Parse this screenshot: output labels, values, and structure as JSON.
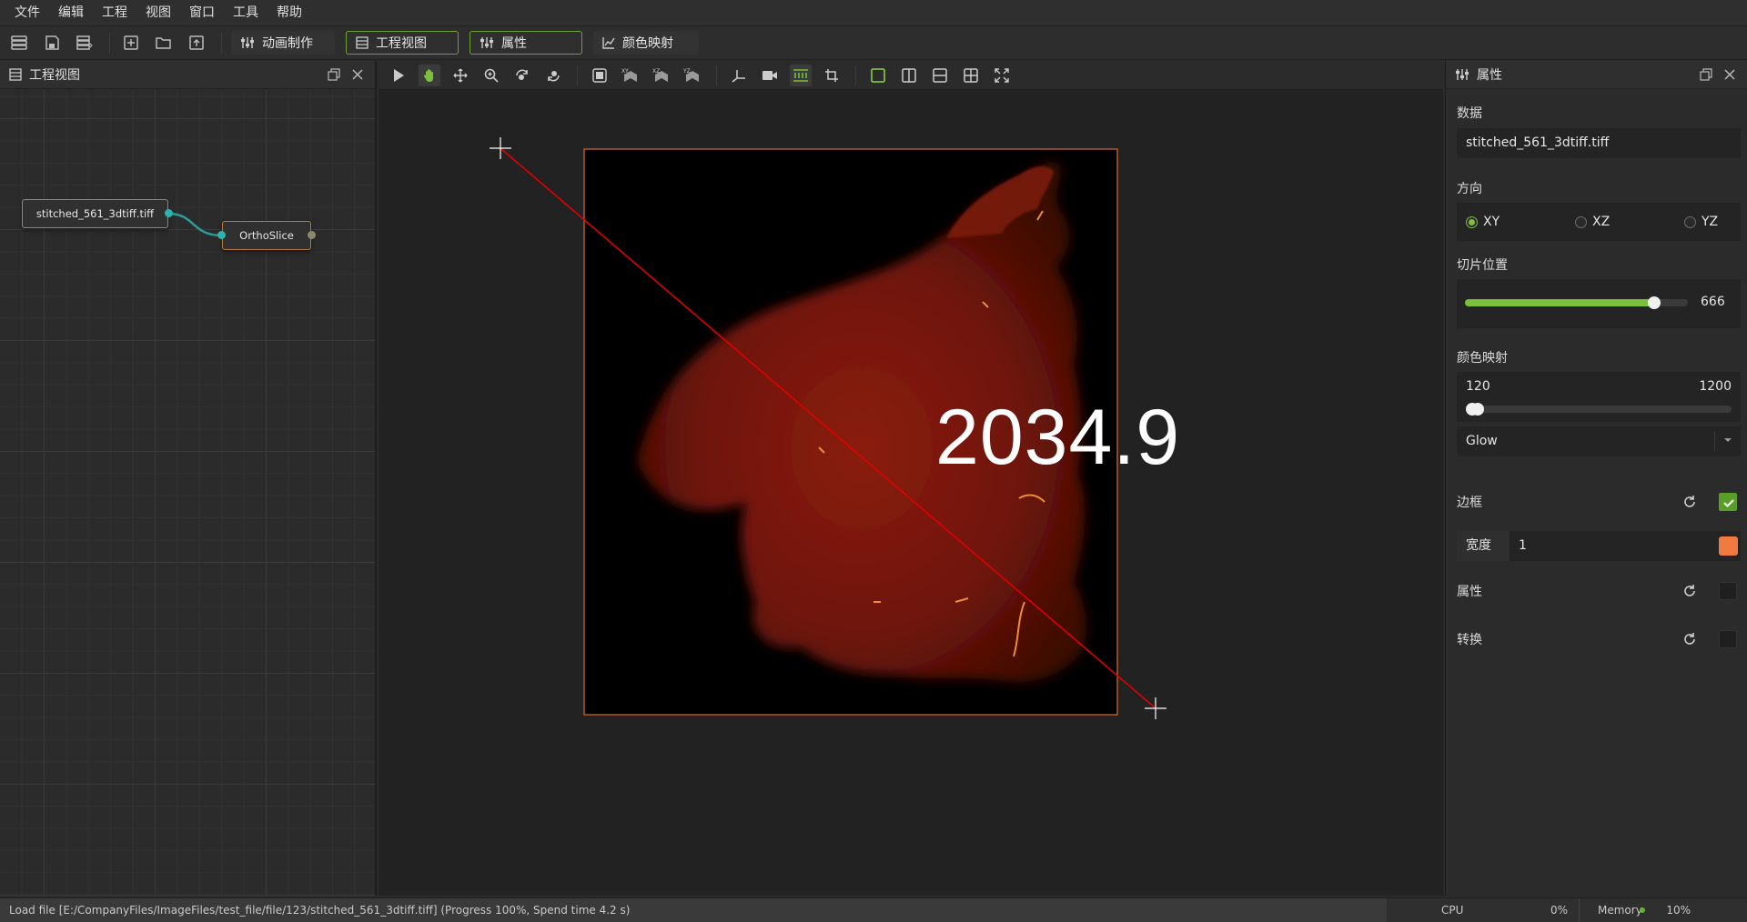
{
  "menu": [
    "文件",
    "编辑",
    "工程",
    "视图",
    "窗口",
    "工具",
    "帮助"
  ],
  "toolbar": {
    "tabs": [
      {
        "label": "动画制作",
        "icon": "sliders-icon"
      },
      {
        "label": "工程视图",
        "icon": "list-icon"
      },
      {
        "label": "属性",
        "icon": "sliders-icon"
      },
      {
        "label": "颜色映射",
        "icon": "chart-icon"
      }
    ],
    "active_tabs": [
      "工程视图",
      "属性"
    ]
  },
  "project_view": {
    "title": "工程视图",
    "nodes": {
      "data_node": "stitched_561_3dtiff.tiff",
      "slice_node": "OrthoSlice"
    }
  },
  "viewer": {
    "measurement": "2034.9",
    "accent_color": "#e06a2a",
    "line_color": "#e00000"
  },
  "properties": {
    "title": "属性",
    "data_label": "数据",
    "data_value": "stitched_561_3dtiff.tiff",
    "orientation_label": "方向",
    "orientations": [
      "XY",
      "XZ",
      "YZ"
    ],
    "orientation_selected": "XY",
    "slice_label": "切片位置",
    "slice_value": "666",
    "slice_fraction": 0.85,
    "colormap_label": "颜色映射",
    "colormap_min": "120",
    "colormap_max": "1200",
    "colormap_name": "Glow",
    "border_label": "边框",
    "border_checked": true,
    "width_label": "宽度",
    "width_value": "1",
    "width_color": "#f07a40",
    "attr_label": "属性",
    "transform_label": "转换",
    "accent": "#7bbf3a"
  },
  "status": {
    "message": "Load file [E:/CompanyFiles/ImageFiles/test_file/file/123/stitched_561_3dtiff.tiff] (Progress 100%, Spend time 4.2 s)",
    "cpu_label": "CPU",
    "cpu_value": "0%",
    "memory_label": "Memory",
    "memory_value": "10%"
  }
}
